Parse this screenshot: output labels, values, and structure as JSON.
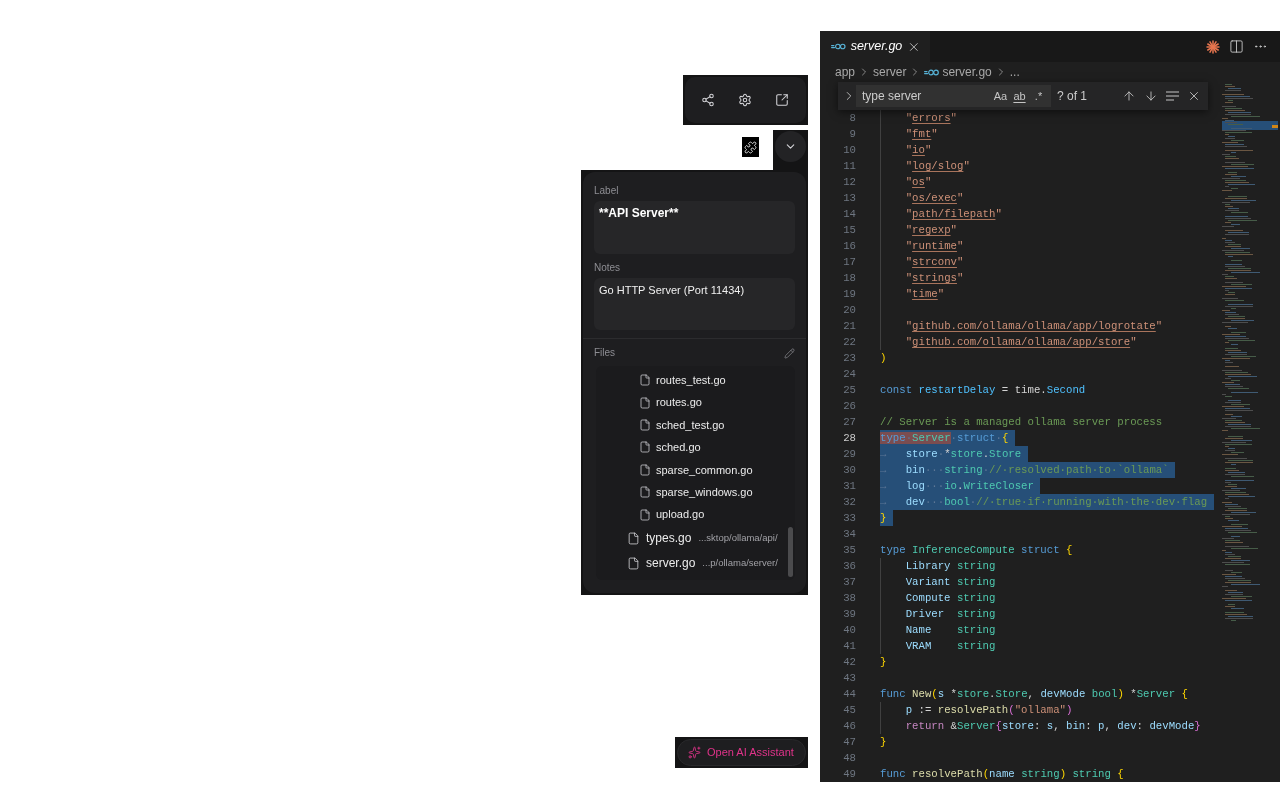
{
  "properties_panel": {
    "label": {
      "caption": "Label",
      "value": "**API Server**"
    },
    "notes": {
      "caption": "Notes",
      "value": "Go HTTP Server (Port 11434)"
    },
    "files": {
      "caption": "Files",
      "items": [
        {
          "children": [
            {
              "name": "routes_test.go"
            },
            {
              "name": "routes.go"
            },
            {
              "name": "sched_test.go"
            },
            {
              "name": "sched.go"
            },
            {
              "name": "sparse_common.go"
            },
            {
              "name": "sparse_windows.go"
            },
            {
              "name": "upload.go"
            }
          ]
        },
        {
          "name": "types.go",
          "path": "...sktop/ollama/api/"
        },
        {
          "name": "server.go",
          "path": "...p/ollama/server/"
        }
      ]
    }
  },
  "assistant_button": {
    "label": "Open AI Assistant"
  },
  "editor": {
    "tabs": [
      {
        "label": "server.go",
        "selected": true,
        "preview": true
      }
    ],
    "breadcrumb": [
      {
        "kind": "folder",
        "label": "app"
      },
      {
        "kind": "folder",
        "label": "server"
      },
      {
        "kind": "file",
        "label": "server.go"
      },
      {
        "kind": "more",
        "label": "..."
      }
    ],
    "find": {
      "value": "type server",
      "options": [
        {
          "label": "Aa",
          "on": false
        },
        {
          "label": "ab",
          "on": false
        },
        {
          "label": ".*",
          "on": false
        }
      ],
      "count": "? of 1"
    },
    "lines": [
      {
        "number": "8",
        "indented": true,
        "selected": false,
        "current": false,
        "tokens": [
          {
            "kind": "string",
            "text": "\""
          },
          {
            "kind": "import_path",
            "text": "errors"
          },
          {
            "kind": "string",
            "text": "\""
          }
        ]
      },
      {
        "number": "9",
        "indented": true,
        "selected": false,
        "current": false,
        "tokens": [
          {
            "kind": "string",
            "text": "\""
          },
          {
            "kind": "import_path",
            "text": "fmt"
          },
          {
            "kind": "string",
            "text": "\""
          }
        ]
      },
      {
        "number": "10",
        "indented": true,
        "selected": false,
        "current": false,
        "tokens": [
          {
            "kind": "string",
            "text": "\""
          },
          {
            "kind": "import_path",
            "text": "io"
          },
          {
            "kind": "string",
            "text": "\""
          }
        ]
      },
      {
        "number": "11",
        "indented": true,
        "selected": false,
        "current": false,
        "tokens": [
          {
            "kind": "string",
            "text": "\""
          },
          {
            "kind": "import_path",
            "text": "log/slog"
          },
          {
            "kind": "string",
            "text": "\""
          }
        ]
      },
      {
        "number": "12",
        "indented": true,
        "selected": false,
        "current": false,
        "tokens": [
          {
            "kind": "string",
            "text": "\""
          },
          {
            "kind": "import_path",
            "text": "os"
          },
          {
            "kind": "string",
            "text": "\""
          }
        ]
      },
      {
        "number": "13",
        "indented": true,
        "selected": false,
        "current": false,
        "tokens": [
          {
            "kind": "string",
            "text": "\""
          },
          {
            "kind": "import_path",
            "text": "os/exec"
          },
          {
            "kind": "string",
            "text": "\""
          }
        ]
      },
      {
        "number": "14",
        "indented": true,
        "selected": false,
        "current": false,
        "tokens": [
          {
            "kind": "string",
            "text": "\""
          },
          {
            "kind": "import_path",
            "text": "path/filepath"
          },
          {
            "kind": "string",
            "text": "\""
          }
        ]
      },
      {
        "number": "15",
        "indented": true,
        "selected": false,
        "current": false,
        "tokens": [
          {
            "kind": "string",
            "text": "\""
          },
          {
            "kind": "import_path",
            "text": "regexp"
          },
          {
            "kind": "string",
            "text": "\""
          }
        ]
      },
      {
        "number": "16",
        "indented": true,
        "selected": false,
        "current": false,
        "tokens": [
          {
            "kind": "string",
            "text": "\""
          },
          {
            "kind": "import_path",
            "text": "runtime"
          },
          {
            "kind": "string",
            "text": "\""
          }
        ]
      },
      {
        "number": "17",
        "indented": true,
        "selected": false,
        "current": false,
        "tokens": [
          {
            "kind": "string",
            "text": "\""
          },
          {
            "kind": "import_path",
            "text": "strconv"
          },
          {
            "kind": "string",
            "text": "\""
          }
        ]
      },
      {
        "number": "18",
        "indented": true,
        "selected": false,
        "current": false,
        "tokens": [
          {
            "kind": "string",
            "text": "\""
          },
          {
            "kind": "import_path",
            "text": "strings"
          },
          {
            "kind": "string",
            "text": "\""
          }
        ]
      },
      {
        "number": "19",
        "indented": true,
        "selected": false,
        "current": false,
        "tokens": [
          {
            "kind": "string",
            "text": "\""
          },
          {
            "kind": "import_path",
            "text": "time"
          },
          {
            "kind": "string",
            "text": "\""
          }
        ]
      },
      {
        "number": "20",
        "indented": true,
        "selected": false,
        "current": false
      },
      {
        "number": "21",
        "indented": true,
        "selected": false,
        "current": false,
        "tokens": [
          {
            "kind": "string",
            "text": "\""
          },
          {
            "kind": "import_path",
            "text": "github.com/ollama/ollama/app/logrotate"
          },
          {
            "kind": "string",
            "text": "\""
          }
        ]
      },
      {
        "number": "22",
        "indented": true,
        "selected": false,
        "current": false,
        "tokens": [
          {
            "kind": "string",
            "text": "\""
          },
          {
            "kind": "import_path",
            "text": "github.com/ollama/ollama/app/store"
          },
          {
            "kind": "string",
            "text": "\""
          }
        ]
      },
      {
        "number": "23",
        "indented": false,
        "selected": false,
        "current": false,
        "tokens": [
          {
            "kind": "bracket",
            "text": ")"
          }
        ]
      },
      {
        "number": "24",
        "indented": false,
        "selected": false,
        "current": false
      },
      {
        "number": "25",
        "indented": false,
        "selected": false,
        "current": false,
        "tokens": [
          {
            "kind": "keyword",
            "text": "const "
          },
          {
            "kind": "constant",
            "text": "restartDelay"
          },
          {
            "kind": "plain",
            "text": " = time."
          },
          {
            "kind": "constant",
            "text": "Second"
          }
        ]
      },
      {
        "number": "26",
        "indented": false,
        "selected": false,
        "current": false
      },
      {
        "number": "27",
        "indented": false,
        "selected": false,
        "current": false,
        "tokens": [
          {
            "kind": "comment",
            "text": "// Server is a managed ollama server process"
          }
        ]
      },
      {
        "number": "28",
        "indented": false,
        "selected": true,
        "current": true,
        "tokens": [
          {
            "kind": "match",
            "children": [
              {
                "kind": "keyword",
                "text": "type"
              },
              {
                "kind": "whitespace",
                "text": "·"
              },
              {
                "kind": "type",
                "text": "Server"
              }
            ]
          },
          {
            "kind": "whitespace",
            "text": "·"
          },
          {
            "kind": "keyword",
            "text": "struct"
          },
          {
            "kind": "whitespace",
            "text": "·"
          },
          {
            "kind": "bracket",
            "text": "{"
          }
        ]
      },
      {
        "number": "29",
        "indented": false,
        "selected": true,
        "current": false,
        "tokens": [
          {
            "kind": "tab",
            "text": "→"
          },
          {
            "kind": "variable",
            "text": "store"
          },
          {
            "kind": "whitespace",
            "text": "·"
          },
          {
            "kind": "plain",
            "text": "*"
          },
          {
            "kind": "type",
            "text": "store"
          },
          {
            "kind": "plain",
            "text": "."
          },
          {
            "kind": "type",
            "text": "Store"
          }
        ]
      },
      {
        "number": "30",
        "indented": false,
        "selected": true,
        "current": false,
        "tokens": [
          {
            "kind": "tab",
            "text": "→"
          },
          {
            "kind": "variable",
            "text": "bin"
          },
          {
            "kind": "whitespace",
            "text": "···"
          },
          {
            "kind": "type",
            "text": "string"
          },
          {
            "kind": "whitespace",
            "text": "·"
          },
          {
            "kind": "comment",
            "text": "//·resolved·path·to·`ollama`"
          }
        ]
      },
      {
        "number": "31",
        "indented": false,
        "selected": true,
        "current": false,
        "tokens": [
          {
            "kind": "tab",
            "text": "→"
          },
          {
            "kind": "variable",
            "text": "log"
          },
          {
            "kind": "whitespace",
            "text": "···"
          },
          {
            "kind": "type",
            "text": "io"
          },
          {
            "kind": "plain",
            "text": "."
          },
          {
            "kind": "type",
            "text": "WriteCloser"
          }
        ]
      },
      {
        "number": "32",
        "indented": false,
        "selected": true,
        "current": false,
        "tokens": [
          {
            "kind": "tab",
            "text": "→"
          },
          {
            "kind": "variable",
            "text": "dev"
          },
          {
            "kind": "whitespace",
            "text": "···"
          },
          {
            "kind": "type",
            "text": "bool"
          },
          {
            "kind": "whitespace",
            "text": "·"
          },
          {
            "kind": "comment",
            "text": "//·true·if·running·with·the·dev·flag"
          }
        ]
      },
      {
        "number": "33",
        "indented": false,
        "selected": true,
        "current": false,
        "tokens": [
          {
            "kind": "bracket",
            "text": "}"
          }
        ]
      },
      {
        "number": "34",
        "indented": false,
        "selected": false,
        "current": false
      },
      {
        "number": "35",
        "indented": false,
        "selected": false,
        "current": false,
        "tokens": [
          {
            "kind": "keyword",
            "text": "type "
          },
          {
            "kind": "type",
            "text": "InferenceCompute "
          },
          {
            "kind": "keyword",
            "text": "struct "
          },
          {
            "kind": "bracket",
            "text": "{"
          }
        ]
      },
      {
        "number": "36",
        "indented": true,
        "selected": false,
        "current": false,
        "tokens": [
          {
            "kind": "variable",
            "text": "Library "
          },
          {
            "kind": "type",
            "text": "string"
          }
        ]
      },
      {
        "number": "37",
        "indented": true,
        "selected": false,
        "current": false,
        "tokens": [
          {
            "kind": "variable",
            "text": "Variant "
          },
          {
            "kind": "type",
            "text": "string"
          }
        ]
      },
      {
        "number": "38",
        "indented": true,
        "selected": false,
        "current": false,
        "tokens": [
          {
            "kind": "variable",
            "text": "Compute "
          },
          {
            "kind": "type",
            "text": "string"
          }
        ]
      },
      {
        "number": "39",
        "indented": true,
        "selected": false,
        "current": false,
        "tokens": [
          {
            "kind": "variable",
            "text": "Driver  "
          },
          {
            "kind": "type",
            "text": "string"
          }
        ]
      },
      {
        "number": "40",
        "indented": true,
        "selected": false,
        "current": false,
        "tokens": [
          {
            "kind": "variable",
            "text": "Name    "
          },
          {
            "kind": "type",
            "text": "string"
          }
        ]
      },
      {
        "number": "41",
        "indented": true,
        "selected": false,
        "current": false,
        "tokens": [
          {
            "kind": "variable",
            "text": "VRAM    "
          },
          {
            "kind": "type",
            "text": "string"
          }
        ]
      },
      {
        "number": "42",
        "indented": false,
        "selected": false,
        "current": false,
        "tokens": [
          {
            "kind": "bracket",
            "text": "}"
          }
        ]
      },
      {
        "number": "43",
        "indented": false,
        "selected": false,
        "current": false
      },
      {
        "number": "44",
        "indented": false,
        "selected": false,
        "current": false,
        "tokens": [
          {
            "kind": "keyword",
            "text": "func "
          },
          {
            "kind": "function",
            "text": "New"
          },
          {
            "kind": "bracket",
            "text": "("
          },
          {
            "kind": "variable",
            "text": "s"
          },
          {
            "kind": "plain",
            "text": " *"
          },
          {
            "kind": "type",
            "text": "store"
          },
          {
            "kind": "plain",
            "text": "."
          },
          {
            "kind": "type",
            "text": "Store"
          },
          {
            "kind": "plain",
            "text": ", "
          },
          {
            "kind": "variable",
            "text": "devMode "
          },
          {
            "kind": "type",
            "text": "bool"
          },
          {
            "kind": "bracket",
            "text": ")"
          },
          {
            "kind": "plain",
            "text": " *"
          },
          {
            "kind": "type",
            "text": "Server "
          },
          {
            "kind": "bracket",
            "text": "{"
          }
        ]
      },
      {
        "number": "45",
        "indented": true,
        "selected": false,
        "current": false,
        "tokens": [
          {
            "kind": "variable",
            "text": "p"
          },
          {
            "kind": "plain",
            "text": " := "
          },
          {
            "kind": "function",
            "text": "resolvePath"
          },
          {
            "kind": "nested_bracket",
            "text": "("
          },
          {
            "kind": "string",
            "text": "\"ollama\""
          },
          {
            "kind": "nested_bracket",
            "text": ")"
          }
        ]
      },
      {
        "number": "46",
        "indented": true,
        "selected": false,
        "current": false,
        "tokens": [
          {
            "kind": "control",
            "text": "return "
          },
          {
            "kind": "plain",
            "text": "&"
          },
          {
            "kind": "type",
            "text": "Server"
          },
          {
            "kind": "nested_bracket",
            "text": "{"
          },
          {
            "kind": "variable",
            "text": "store"
          },
          {
            "kind": "plain",
            "text": ": "
          },
          {
            "kind": "variable",
            "text": "s"
          },
          {
            "kind": "plain",
            "text": ", "
          },
          {
            "kind": "variable",
            "text": "bin"
          },
          {
            "kind": "plain",
            "text": ": "
          },
          {
            "kind": "variable",
            "text": "p"
          },
          {
            "kind": "plain",
            "text": ", "
          },
          {
            "kind": "variable",
            "text": "dev"
          },
          {
            "kind": "plain",
            "text": ": "
          },
          {
            "kind": "variable",
            "text": "devMode"
          },
          {
            "kind": "nested_bracket",
            "text": "}"
          }
        ]
      },
      {
        "number": "47",
        "indented": false,
        "selected": false,
        "current": false,
        "tokens": [
          {
            "kind": "bracket",
            "text": "}"
          }
        ]
      },
      {
        "number": "48",
        "indented": false,
        "selected": false,
        "current": false
      },
      {
        "number": "49",
        "indented": false,
        "selected": false,
        "current": false,
        "tokens": [
          {
            "kind": "keyword",
            "text": "func "
          },
          {
            "kind": "function",
            "text": "resolvePath"
          },
          {
            "kind": "bracket",
            "text": "("
          },
          {
            "kind": "variable",
            "text": "name "
          },
          {
            "kind": "type",
            "text": "string"
          },
          {
            "kind": "bracket",
            "text": ")"
          },
          {
            "kind": "type",
            "text": " string "
          },
          {
            "kind": "bracket",
            "text": "{"
          }
        ]
      }
    ]
  }
}
